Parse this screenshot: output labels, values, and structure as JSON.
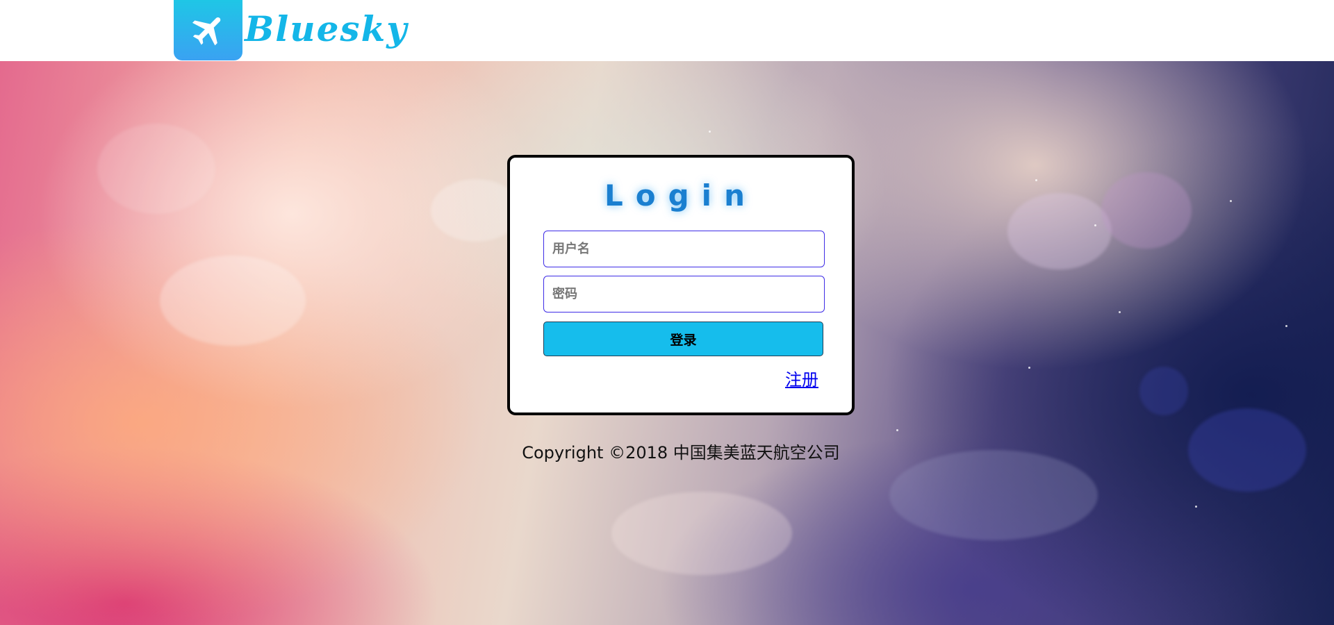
{
  "header": {
    "brand_name": "Bluesky",
    "logo_icon": "airplane-icon",
    "brand_color": "#14b6e8"
  },
  "login": {
    "title": "Login",
    "username_placeholder": "用户名",
    "password_placeholder": "密码",
    "login_button_label": "登录",
    "register_link_label": "注册",
    "accent_color": "#16bdec"
  },
  "footer": {
    "copyright": "Copyright ©2018 中国集美蓝天航空公司"
  }
}
